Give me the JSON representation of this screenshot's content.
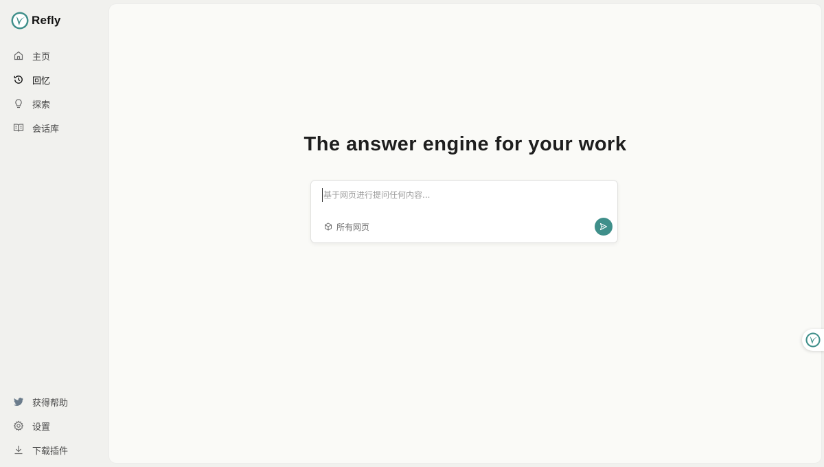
{
  "app": {
    "name": "Refly"
  },
  "sidebar": {
    "top_items": [
      {
        "label": "主页",
        "icon": "home-icon",
        "active": false
      },
      {
        "label": "回忆",
        "icon": "history-icon",
        "active": true
      },
      {
        "label": "探索",
        "icon": "lightbulb-icon",
        "active": false
      },
      {
        "label": "会话库",
        "icon": "book-icon",
        "active": false
      }
    ],
    "bottom_items": [
      {
        "label": "获得帮助",
        "icon": "twitter-icon"
      },
      {
        "label": "设置",
        "icon": "gear-icon"
      },
      {
        "label": "下载插件",
        "icon": "download-icon"
      }
    ]
  },
  "main": {
    "headline": "The answer engine for your work",
    "ask": {
      "placeholder": "基于网页进行提问任何内容...",
      "value": "",
      "scope_label": "所有网页"
    }
  },
  "colors": {
    "accent": "#3f8f8a",
    "sidebar_bg": "#f1f1ee",
    "main_bg": "#fafaf7"
  }
}
